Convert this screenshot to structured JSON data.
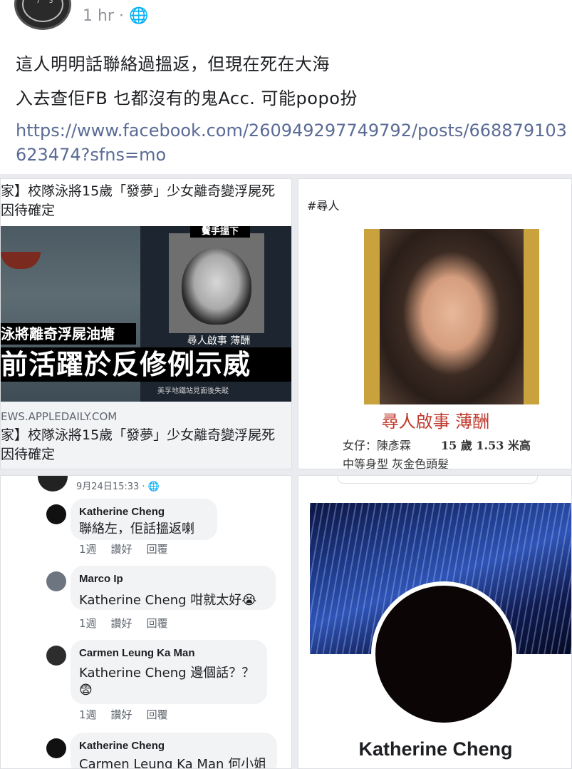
{
  "header": {
    "time": "1 hr · 🌐"
  },
  "post": {
    "line1": "這人明明話聯絡過搵返，但現在死在大海",
    "line2": "入去查佢FB 乜都沒有的鬼Acc. 可能popo扮",
    "link": "https://www.facebook.com/260949297749792/posts/668879103623474?sfns=mo"
  },
  "article": {
    "title_top": "家】校隊泳將15歲「發夢」少女離奇變浮屍死因待確定",
    "photo_caption": "尋人啟事 薄酬",
    "photo_tag": "鬢手搵下",
    "overlay_small": "泳將離奇浮屍油塘",
    "overlay_big": "前活躍於反修例示威",
    "subcaption": "美孚地鐵站見面後失蹤",
    "info_icon": "i",
    "source": "EWS.APPLEDAILY.COM",
    "title_bottom": "家】校隊泳將15歲「發夢」少女離奇變浮屍死因待確定"
  },
  "missing": {
    "hashtag": "#尋人",
    "title": "尋人啟事 薄酬",
    "line1_a": "女仔：陳彥霖",
    "line1_b": "15 歲 1.53 米高",
    "line2": "中等身型 灰金色頭髮"
  },
  "comments": {
    "timestamp": "9月24日15:33 · 🌐",
    "items": [
      {
        "name": "Katherine Cheng",
        "text": "聯絡左，佢話搵返喇",
        "text2": "",
        "meta": [
          "1週",
          "讚好",
          "回覆"
        ]
      },
      {
        "name": "Marco Ip",
        "text": "Katherine Cheng 咁就太好😭",
        "text2": "",
        "meta": [
          "1週",
          "讚好",
          "回覆"
        ]
      },
      {
        "name": "Carmen Leung Ka Man",
        "text": "Katherine Cheng 邊個話？？",
        "text2": "😨",
        "meta": [
          "1週",
          "讚好",
          "回覆"
        ]
      },
      {
        "name": "Katherine Cheng",
        "text": "Carmen Leung Ka Man 何小姐",
        "text2": "",
        "meta": []
      }
    ]
  },
  "profile": {
    "name": "Katherine Cheng"
  }
}
